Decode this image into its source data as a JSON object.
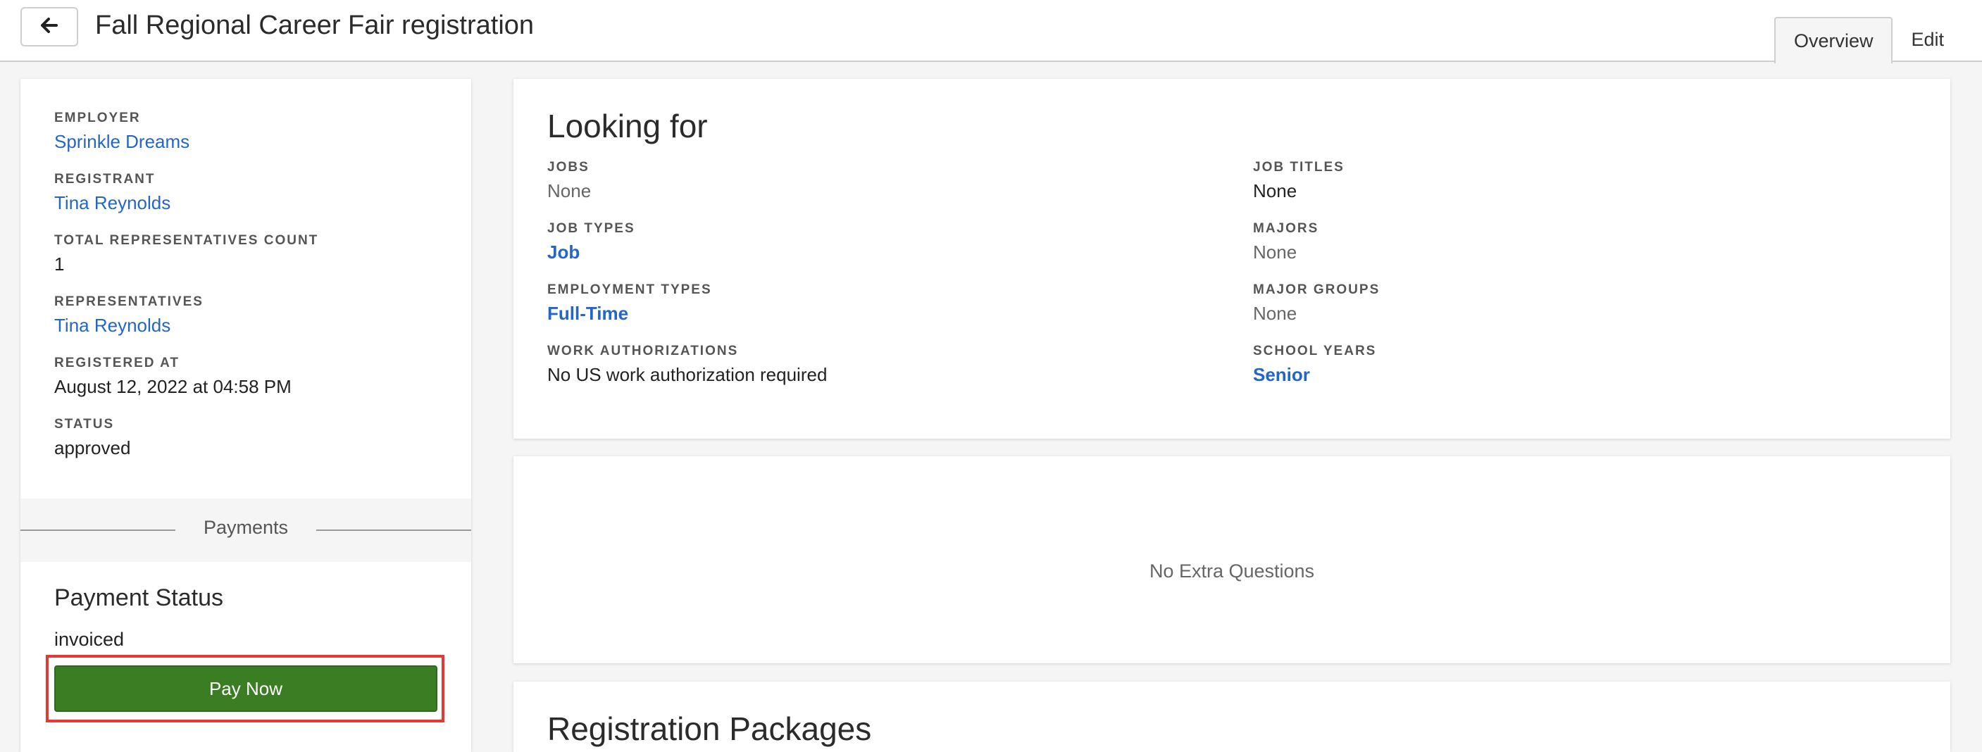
{
  "header": {
    "title": "Fall Regional Career Fair registration",
    "back_icon": "arrow-left-icon",
    "tabs": [
      {
        "label": "Overview",
        "active": true
      },
      {
        "label": "Edit",
        "active": false
      }
    ]
  },
  "sidebar": {
    "employer_label": "EMPLOYER",
    "employer_value": "Sprinkle Dreams",
    "registrant_label": "REGISTRANT",
    "registrant_value": "Tina Reynolds",
    "total_reps_label": "TOTAL REPRESENTATIVES COUNT",
    "total_reps_value": "1",
    "reps_label": "REPRESENTATIVES",
    "reps_value": "Tina Reynolds",
    "registered_label": "REGISTERED AT",
    "registered_value": "August 12, 2022 at 04:58 PM",
    "status_label": "STATUS",
    "status_value": "approved",
    "payments_divider": "Payments",
    "payment_status_title": "Payment Status",
    "payment_status_value": "invoiced",
    "pay_button": "Pay Now"
  },
  "looking_for": {
    "title": "Looking for",
    "left": [
      {
        "label": "JOBS",
        "value": "None"
      },
      {
        "label": "JOB TYPES",
        "value": "Job"
      },
      {
        "label": "EMPLOYMENT TYPES",
        "value": "Full-Time"
      },
      {
        "label": "WORK AUTHORIZATIONS",
        "value": "No US work authorization required"
      }
    ],
    "right": [
      {
        "label": "JOB TITLES",
        "value": "None"
      },
      {
        "label": "MAJORS",
        "value": "None"
      },
      {
        "label": "MAJOR GROUPS",
        "value": "None"
      },
      {
        "label": "SCHOOL YEARS",
        "value": "Senior"
      }
    ]
  },
  "extra_questions": {
    "empty_text": "No Extra Questions"
  },
  "registration_packages": {
    "title": "Registration Packages"
  },
  "colors": {
    "link": "#2366c7",
    "pay_button": "#3a7d23",
    "highlight": "#e53935"
  }
}
